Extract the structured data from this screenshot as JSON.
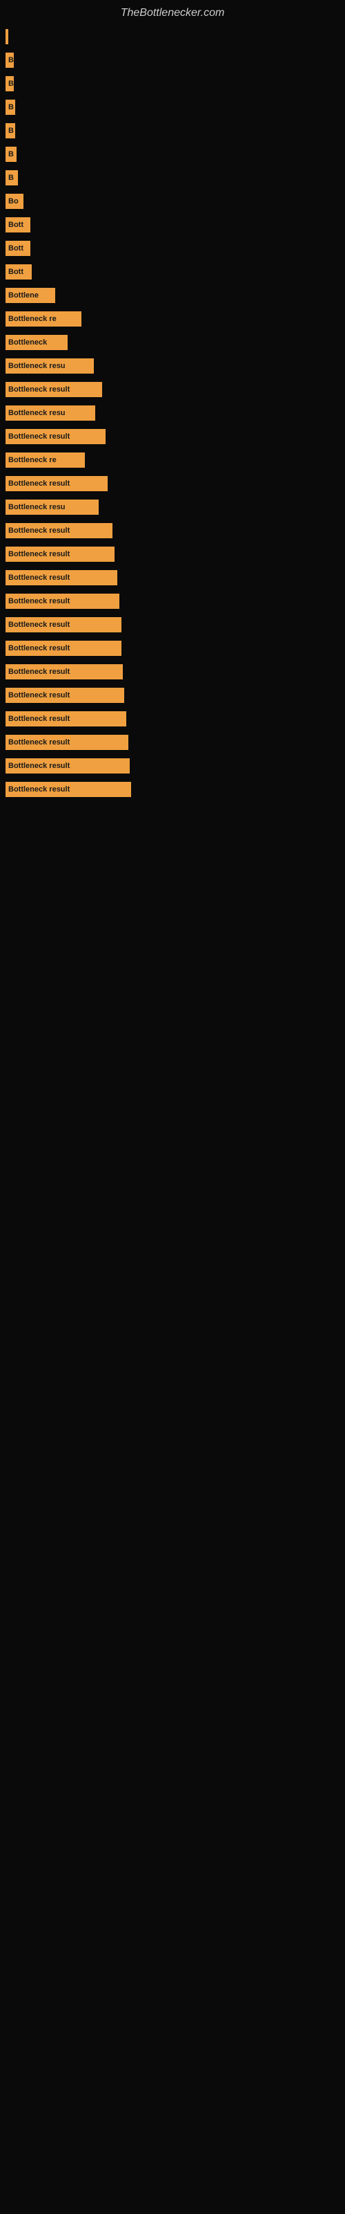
{
  "site_title": "TheBottlenecker.com",
  "bars": [
    {
      "label": "",
      "width": 4
    },
    {
      "label": "B",
      "width": 12
    },
    {
      "label": "B",
      "width": 12
    },
    {
      "label": "B",
      "width": 14
    },
    {
      "label": "B",
      "width": 14
    },
    {
      "label": "B",
      "width": 16
    },
    {
      "label": "B",
      "width": 18
    },
    {
      "label": "Bo",
      "width": 26
    },
    {
      "label": "Bott",
      "width": 36
    },
    {
      "label": "Bott",
      "width": 36
    },
    {
      "label": "Bott",
      "width": 38
    },
    {
      "label": "Bottlene",
      "width": 72
    },
    {
      "label": "Bottleneck re",
      "width": 110
    },
    {
      "label": "Bottleneck",
      "width": 90
    },
    {
      "label": "Bottleneck resu",
      "width": 128
    },
    {
      "label": "Bottleneck result",
      "width": 140
    },
    {
      "label": "Bottleneck resu",
      "width": 130
    },
    {
      "label": "Bottleneck result",
      "width": 145
    },
    {
      "label": "Bottleneck re",
      "width": 115
    },
    {
      "label": "Bottleneck result",
      "width": 148
    },
    {
      "label": "Bottleneck resu",
      "width": 135
    },
    {
      "label": "Bottleneck result",
      "width": 155
    },
    {
      "label": "Bottleneck result",
      "width": 158
    },
    {
      "label": "Bottleneck result",
      "width": 162
    },
    {
      "label": "Bottleneck result",
      "width": 165
    },
    {
      "label": "Bottleneck result",
      "width": 168
    },
    {
      "label": "Bottleneck result",
      "width": 168
    },
    {
      "label": "Bottleneck result",
      "width": 170
    },
    {
      "label": "Bottleneck result",
      "width": 172
    },
    {
      "label": "Bottleneck result",
      "width": 175
    },
    {
      "label": "Bottleneck result",
      "width": 178
    },
    {
      "label": "Bottleneck result",
      "width": 180
    },
    {
      "label": "Bottleneck result",
      "width": 182
    }
  ]
}
